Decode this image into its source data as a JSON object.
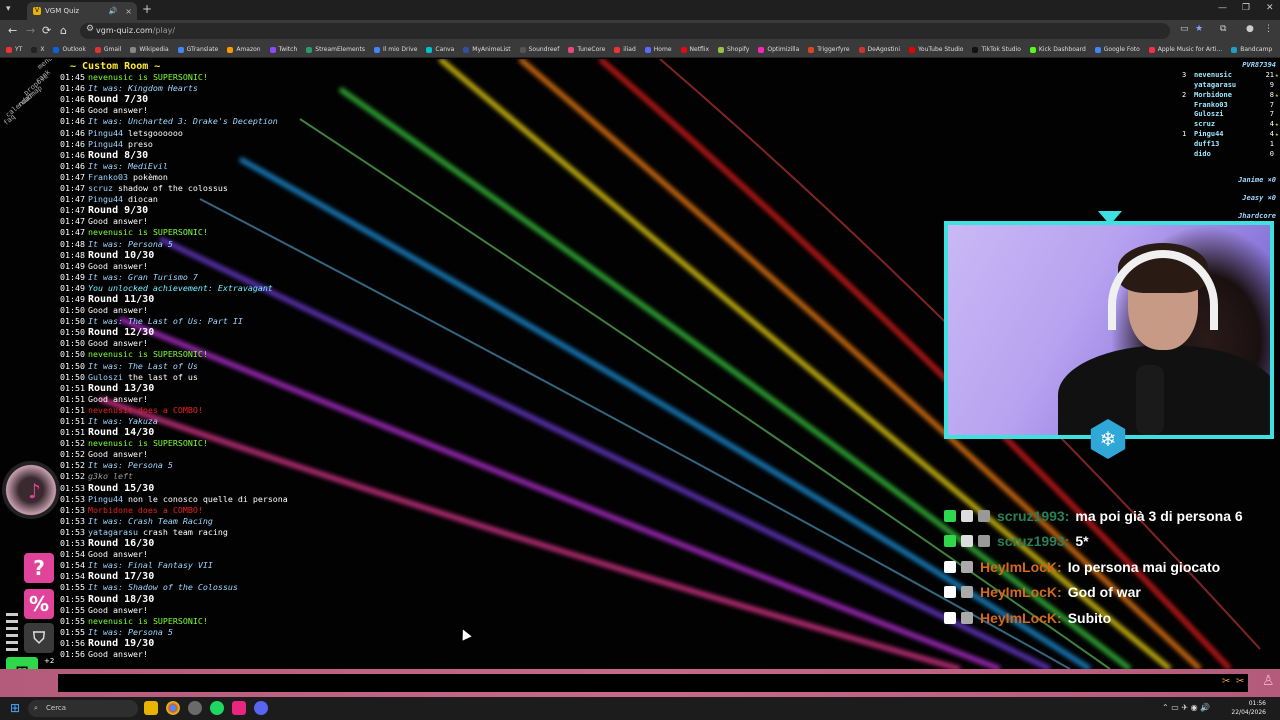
{
  "browser": {
    "tab_title": "VGM Quiz",
    "url_host": "vgm-quiz.com",
    "url_path": "/play/",
    "bookmarks": [
      "YT",
      "X",
      "Outlook",
      "Gmail",
      "Wikipedia",
      "GTranslate",
      "Amazon",
      "Twitch",
      "StreamElements",
      "Il mio Drive",
      "Canva",
      "MyAnimeList",
      "Soundreef",
      "TuneCore",
      "iliad",
      "Home",
      "Netflix",
      "Shopify",
      "Optimizilla",
      "Triggerfyre",
      "DeAgostini",
      "YouTube Studio",
      "TikTok Studio",
      "Kick Dashboard",
      "Google Foto",
      "Apple Music for Arti...",
      "Bandcamp"
    ]
  },
  "left_menu": [
    "menu",
    "rank",
    "propose",
    "roadmap",
    "calendar",
    "faq"
  ],
  "room_title": "~ Custom Room ~",
  "log": [
    {
      "t": "01:45",
      "type": "super",
      "user": "nevenusic",
      "text": "is SUPERSONIC!"
    },
    {
      "t": "01:46",
      "type": "was",
      "text": "It was: Kingdom Hearts"
    },
    {
      "t": "01:46",
      "type": "round",
      "text": "Round 7/30"
    },
    {
      "t": "01:46",
      "type": "good",
      "text": "Good answer!"
    },
    {
      "t": "01:46",
      "type": "was",
      "text": "It was: Uncharted 3: Drake's Deception"
    },
    {
      "t": "01:46",
      "type": "chat",
      "user": "Pingu44",
      "text": "letsgoooooo"
    },
    {
      "t": "01:46",
      "type": "chat",
      "user": "Pingu44",
      "text": "preso"
    },
    {
      "t": "01:46",
      "type": "round",
      "text": "Round 8/30"
    },
    {
      "t": "01:46",
      "type": "was",
      "text": "It was: MediEvil"
    },
    {
      "t": "01:47",
      "type": "chat",
      "user": "Franko03",
      "text": "pokèmon"
    },
    {
      "t": "01:47",
      "type": "chat",
      "user": "scruz",
      "text": "shadow of the colossus"
    },
    {
      "t": "01:47",
      "type": "chat",
      "user": "Pingu44",
      "text": "diocan"
    },
    {
      "t": "01:47",
      "type": "round",
      "text": "Round 9/30"
    },
    {
      "t": "01:47",
      "type": "good",
      "text": "Good answer!"
    },
    {
      "t": "01:47",
      "type": "super",
      "user": "nevenusic",
      "text": "is SUPERSONIC!"
    },
    {
      "t": "01:48",
      "type": "was",
      "text": "It was: Persona 5"
    },
    {
      "t": "01:48",
      "type": "round",
      "text": "Round 10/30"
    },
    {
      "t": "01:49",
      "type": "good",
      "text": "Good answer!"
    },
    {
      "t": "01:49",
      "type": "was",
      "text": "It was: Gran Turismo 7"
    },
    {
      "t": "01:49",
      "type": "ach",
      "text": "You unlocked achievement: Extravagant"
    },
    {
      "t": "01:49",
      "type": "round",
      "text": "Round 11/30"
    },
    {
      "t": "01:50",
      "type": "good",
      "text": "Good answer!"
    },
    {
      "t": "01:50",
      "type": "was",
      "text": "It was: The Last of Us: Part II"
    },
    {
      "t": "01:50",
      "type": "round",
      "text": "Round 12/30"
    },
    {
      "t": "01:50",
      "type": "good",
      "text": "Good answer!"
    },
    {
      "t": "01:50",
      "type": "super",
      "user": "nevenusic",
      "text": "is SUPERSONIC!"
    },
    {
      "t": "01:50",
      "type": "was",
      "text": "It was: The Last of Us"
    },
    {
      "t": "01:50",
      "type": "chat",
      "user": "Guloszi",
      "text": "the last of us"
    },
    {
      "t": "01:51",
      "type": "round",
      "text": "Round 13/30"
    },
    {
      "t": "01:51",
      "type": "good",
      "text": "Good answer!"
    },
    {
      "t": "01:51",
      "type": "combo",
      "text": "nevenusic does a COMBO!"
    },
    {
      "t": "01:51",
      "type": "was",
      "text": "It was: Yakuza"
    },
    {
      "t": "01:51",
      "type": "round",
      "text": "Round 14/30"
    },
    {
      "t": "01:52",
      "type": "super",
      "user": "nevenusic",
      "text": "is SUPERSONIC!"
    },
    {
      "t": "01:52",
      "type": "good",
      "text": "Good answer!"
    },
    {
      "t": "01:52",
      "type": "was",
      "text": "It was: Persona 5"
    },
    {
      "t": "01:52",
      "type": "left",
      "text": "g3ko left"
    },
    {
      "t": "01:53",
      "type": "round",
      "text": "Round 15/30"
    },
    {
      "t": "01:53",
      "type": "chat",
      "user": "Pingu44",
      "text": "non le conosco quelle di persona"
    },
    {
      "t": "01:53",
      "type": "combo",
      "text": "Morbidone does a COMBO!"
    },
    {
      "t": "01:53",
      "type": "was",
      "text": "It was: Crash Team Racing"
    },
    {
      "t": "01:53",
      "type": "chat",
      "user": "yatagarasu",
      "text": "crash team racing"
    },
    {
      "t": "01:53",
      "type": "round",
      "text": "Round 16/30"
    },
    {
      "t": "01:54",
      "type": "good",
      "text": "Good answer!"
    },
    {
      "t": "01:54",
      "type": "was",
      "text": "It was: Final Fantasy VII"
    },
    {
      "t": "01:54",
      "type": "round",
      "text": "Round 17/30"
    },
    {
      "t": "01:55",
      "type": "was",
      "text": "It was: Shadow of the Colossus"
    },
    {
      "t": "01:55",
      "type": "round",
      "text": "Round 18/30"
    },
    {
      "t": "01:55",
      "type": "good",
      "text": "Good answer!"
    },
    {
      "t": "01:55",
      "type": "super",
      "user": "nevenusic",
      "text": "is SUPERSONIC!"
    },
    {
      "t": "01:55",
      "type": "was",
      "text": "It was: Persona 5"
    },
    {
      "t": "01:56",
      "type": "round",
      "text": "Round 19/30"
    },
    {
      "t": "01:56",
      "type": "good",
      "text": "Good answer!"
    }
  ],
  "scoreboard": {
    "header": "PVR87394",
    "rows": [
      {
        "rank": "3",
        "name": "nevenusic",
        "score": "21",
        "star": true
      },
      {
        "rank": "",
        "name": "yatagarasu",
        "score": "9",
        "star": false
      },
      {
        "rank": "2",
        "name": "Morbidone",
        "score": "8",
        "star": true
      },
      {
        "rank": "",
        "name": "Franko03",
        "score": "7",
        "star": false
      },
      {
        "rank": "",
        "name": "Guloszi",
        "score": "7",
        "star": false
      },
      {
        "rank": "",
        "name": "scruz",
        "score": "4",
        "star": true
      },
      {
        "rank": "1",
        "name": "Pingu44",
        "score": "4",
        "star": true
      },
      {
        "rank": "",
        "name": "duff13",
        "score": "1",
        "star": false
      },
      {
        "rank": "",
        "name": "dido",
        "score": "0",
        "star": false
      }
    ],
    "categories": [
      "Janime ×0",
      "Jeasy ×0",
      "Jhardcore"
    ]
  },
  "stream_chat": [
    {
      "user": "scruz1993:",
      "msg": "ma poi già 3 di persona 6",
      "color": "#2a7f5a"
    },
    {
      "user": "scruz1993:",
      "msg": "5*",
      "color": "#2a7f5a"
    },
    {
      "user": "HeyImLocK:",
      "msg": "Io persona mai giocato",
      "color": "#d2691e"
    },
    {
      "user": "HeyImLocK:",
      "msg": "God of war",
      "color": "#d2691e"
    },
    {
      "user": "HeyImLocK:",
      "msg": "Subito",
      "color": "#d2691e"
    }
  ],
  "side_buttons": {
    "help": "?",
    "percent": "%",
    "badge": "+2"
  },
  "taskbar": {
    "search": "Cerca",
    "time": "01:56",
    "date": "22/04/2026"
  }
}
